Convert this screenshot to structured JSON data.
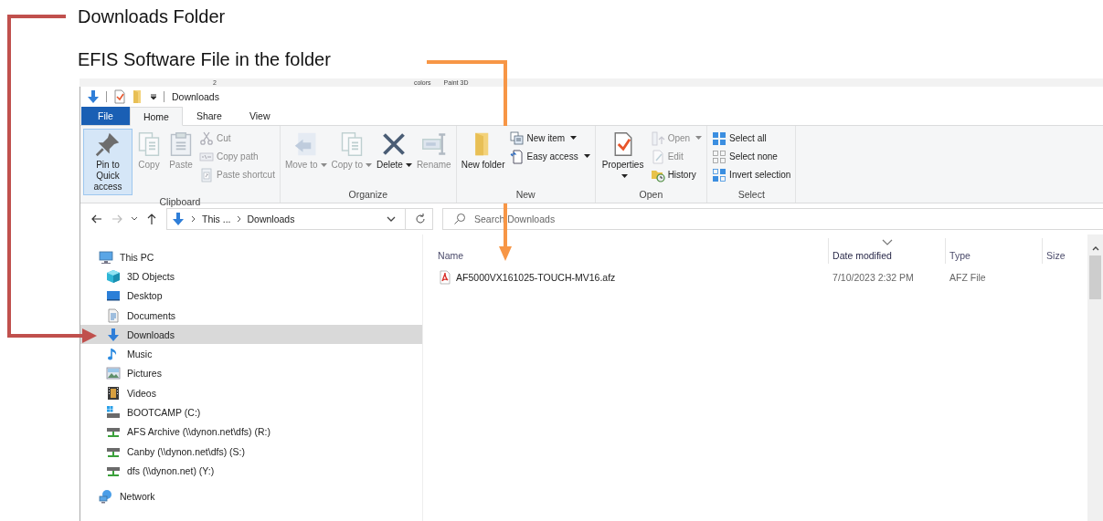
{
  "annotations": [
    {
      "text": "Downloads Folder",
      "color": "#c0504d"
    },
    {
      "text": "EFIS Software File in the folder",
      "color": "#f79646"
    }
  ],
  "background_window": {
    "texts": [
      "2",
      "colors",
      "Paint 3D"
    ]
  },
  "window": {
    "title": "Downloads",
    "tabs": [
      {
        "label": "File",
        "kind": "file",
        "selected": false
      },
      {
        "label": "Home",
        "kind": "tab",
        "selected": true
      },
      {
        "label": "Share",
        "kind": "tab",
        "selected": false
      },
      {
        "label": "View",
        "kind": "tab",
        "selected": false
      }
    ],
    "ribbon": [
      {
        "label": "Clipboard",
        "large": [
          {
            "kind": "pin",
            "label": "Pin to Quick access",
            "disabled": false,
            "highlighted": true,
            "menu": false
          },
          {
            "kind": "copy",
            "label": "Copy",
            "disabled": true,
            "highlighted": false,
            "menu": false
          },
          {
            "kind": "paste",
            "label": "Paste",
            "disabled": true,
            "highlighted": false,
            "menu": false
          }
        ],
        "small": [
          {
            "kind": "cut",
            "label": "Cut",
            "disabled": true,
            "menu": false
          },
          {
            "kind": "copypath",
            "label": "Copy path",
            "disabled": true,
            "menu": false
          },
          {
            "kind": "pasteshortcut",
            "label": "Paste shortcut",
            "disabled": true,
            "menu": false
          }
        ]
      },
      {
        "label": "Organize",
        "large": [
          {
            "kind": "move",
            "label": "Move to",
            "disabled": true,
            "highlighted": false,
            "menu": true
          },
          {
            "kind": "copyto",
            "label": "Copy to",
            "disabled": true,
            "highlighted": false,
            "menu": true
          },
          {
            "kind": "delete",
            "label": "Delete",
            "disabled": false,
            "highlighted": false,
            "menu": true
          },
          {
            "kind": "rename",
            "label": "Rename",
            "disabled": true,
            "highlighted": false,
            "menu": false
          }
        ]
      },
      {
        "label": "New",
        "large": [
          {
            "kind": "newfolder",
            "label": "New folder",
            "disabled": false,
            "highlighted": false,
            "menu": false
          }
        ],
        "small": [
          {
            "kind": "newitem",
            "label": "New item",
            "disabled": false,
            "menu": true
          },
          {
            "kind": "easyaccess",
            "label": "Easy access",
            "disabled": false,
            "menu": true
          }
        ]
      },
      {
        "label": "Open",
        "large": [
          {
            "kind": "properties",
            "label": "Properties",
            "disabled": false,
            "highlighted": false,
            "menu": true
          }
        ],
        "small": [
          {
            "kind": "open",
            "label": "Open",
            "disabled": true,
            "menu": true
          },
          {
            "kind": "edit",
            "label": "Edit",
            "disabled": true,
            "menu": false
          },
          {
            "kind": "history",
            "label": "History",
            "disabled": false,
            "menu": false
          }
        ]
      },
      {
        "label": "Select",
        "small": [
          {
            "kind": "selectall",
            "label": "Select all",
            "disabled": false,
            "menu": false
          },
          {
            "kind": "selectnone",
            "label": "Select none",
            "disabled": false,
            "menu": false
          },
          {
            "kind": "invert",
            "label": "Invert selection",
            "disabled": false,
            "menu": false
          }
        ]
      }
    ],
    "address": {
      "path": [
        "This ...",
        "Downloads"
      ]
    },
    "search": {
      "placeholder": "Search Downloads"
    },
    "nav": [
      {
        "label": "This PC",
        "kind": "pc",
        "selected": false,
        "children": [
          {
            "label": "3D Objects",
            "kind": "cube",
            "selected": false
          },
          {
            "label": "Desktop",
            "kind": "desktop",
            "selected": false
          },
          {
            "label": "Documents",
            "kind": "documents",
            "selected": false
          },
          {
            "label": "Downloads",
            "kind": "downloads",
            "selected": true
          },
          {
            "label": "Music",
            "kind": "music",
            "selected": false
          },
          {
            "label": "Pictures",
            "kind": "pictures",
            "selected": false
          },
          {
            "label": "Videos",
            "kind": "videos",
            "selected": false
          },
          {
            "label": "BOOTCAMP (C:)",
            "kind": "windrive",
            "selected": false
          },
          {
            "label": "AFS Archive (\\\\dynon.net\\dfs) (R:)",
            "kind": "netdrive",
            "selected": false
          },
          {
            "label": "Canby (\\\\dynon.net\\dfs) (S:)",
            "kind": "netdrive",
            "selected": false
          },
          {
            "label": "dfs (\\\\dynon.net) (Y:)",
            "kind": "netdrive",
            "selected": false
          }
        ]
      },
      {
        "label": "Network",
        "kind": "network",
        "selected": false
      }
    ],
    "files": {
      "columns": [
        {
          "label": "Name",
          "sorted": false
        },
        {
          "label": "Date modified",
          "sorted": true
        },
        {
          "label": "Type",
          "sorted": false
        },
        {
          "label": "Size",
          "sorted": false
        }
      ],
      "rows": [
        {
          "name": "AF5000VX161025-TOUCH-MV16.afz",
          "date": "7/10/2023 2:32 PM",
          "type": "AFZ File"
        }
      ]
    }
  }
}
